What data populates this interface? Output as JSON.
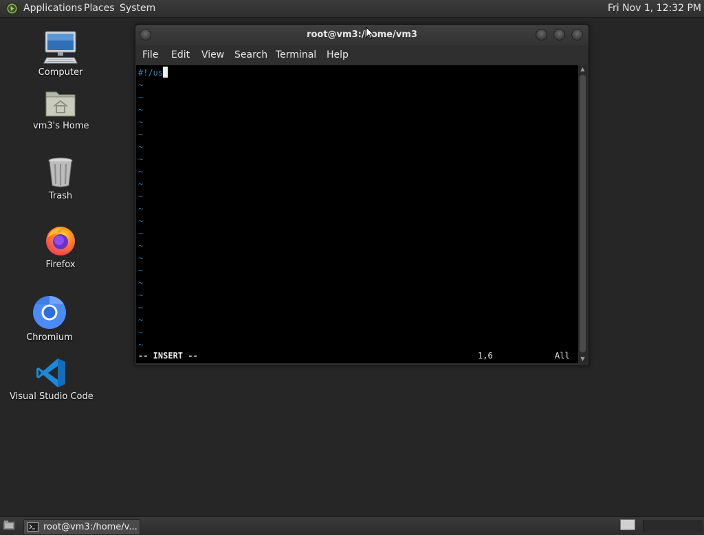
{
  "top_panel": {
    "menus": [
      "Applications",
      "Places",
      "System"
    ],
    "clock": "Fri Nov  1, 12:32 PM"
  },
  "desktop": {
    "icons": [
      {
        "label": "Computer",
        "icon": "computer-icon"
      },
      {
        "label": "vm3's Home",
        "icon": "home-folder-icon"
      },
      {
        "label": "Trash",
        "icon": "trash-icon"
      },
      {
        "label": "Firefox",
        "icon": "firefox-icon"
      },
      {
        "label": "Chromium",
        "icon": "chromium-icon"
      },
      {
        "label": "Visual Studio Code",
        "icon": "vscode-icon"
      }
    ]
  },
  "terminal": {
    "title": "root@vm3:/home/vm3",
    "menu": [
      "File",
      "Edit",
      "View",
      "Search",
      "Terminal",
      "Help"
    ],
    "first_line": "#!/us",
    "empty_line_marker": "~",
    "empty_line_count": 22,
    "mode": "-- INSERT --",
    "position": "1,6",
    "scroll": "All"
  },
  "bottom_panel": {
    "task_label": "root@vm3:/home/v..."
  }
}
